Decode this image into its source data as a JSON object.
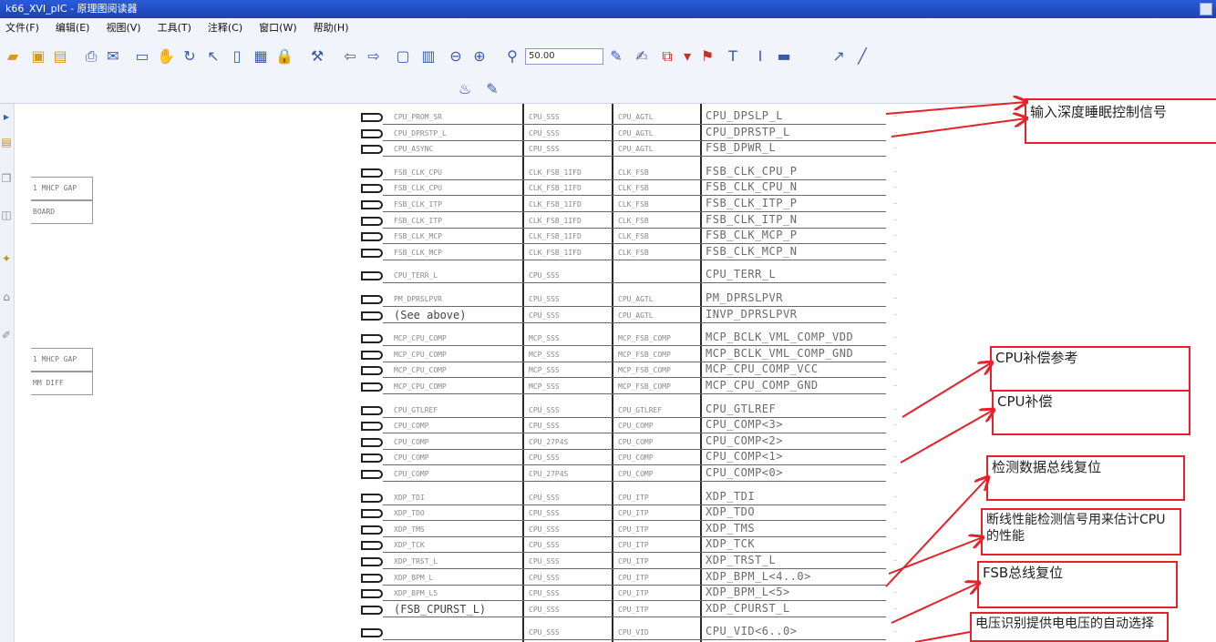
{
  "window": {
    "title": "k66_XVI_pIC   - 原理图阅读器"
  },
  "menu": [
    "文件(F)",
    "编辑(E)",
    "视图(V)",
    "工具(T)",
    "注释(C)",
    "窗口(W)",
    "帮助(H)"
  ],
  "toolbar": {
    "zoom_value": "50.00",
    "icons": [
      "open-folder-icon",
      "save-icon",
      "save-all-icon",
      "print-icon",
      "email-icon",
      "screen-icon",
      "hand-icon",
      "rotate-icon",
      "select-icon",
      "page-icon",
      "image-icon",
      "lock-icon",
      "tools-icon",
      "arrow-left-icon",
      "arrow-right-icon",
      "fit-page-icon",
      "fit-width-icon",
      "zoom-out-icon",
      "zoom-in-icon",
      "binoculars-icon",
      "highlighter-icon",
      "stamp-icon",
      "attach-icon",
      "markup-icon",
      "flag-icon",
      "textbox-icon",
      "text-icon",
      "note-icon",
      "arrow-draw-icon",
      "line-draw-icon"
    ]
  },
  "left_pane": {
    "boxes": [
      {
        "label": "1 MHCP GAP"
      },
      {
        "label": "BOARD"
      },
      {
        "label": "1 MHCP GAP"
      },
      {
        "label": "MM DIFF"
      }
    ]
  },
  "schematic": {
    "rows": [
      {
        "c1": "CPU_PROM_SR",
        "c2": "CPU_SSS",
        "c3": "CPU_AGTL",
        "net": "CPU_DPSLP_L",
        "group": 0
      },
      {
        "c1": "CPU_DPRSTP_L",
        "c2": "CPU_SSS",
        "c3": "CPU_AGTL",
        "net": "CPU_DPRSTP_L",
        "group": 0
      },
      {
        "c1": "CPU_ASYNC",
        "c2": "CPU_SSS",
        "c3": "CPU_AGTL",
        "net": "FSB_DPWR_L",
        "group": 0
      },
      {
        "c1": "FSB_CLK_CPU",
        "c2": "CLK_FSB_1IFD",
        "c3": "CLK_FSB",
        "net": "FSB_CLK_CPU_P",
        "group": 1
      },
      {
        "c1": "FSB_CLK_CPU",
        "c2": "CLK_FSB_1IFD",
        "c3": "CLK_FSB",
        "net": "FSB_CLK_CPU_N",
        "group": 1
      },
      {
        "c1": "FSB_CLK_ITP",
        "c2": "CLK_FSB_1IFD",
        "c3": "CLK_FSB",
        "net": "FSB_CLK_ITP_P",
        "group": 1
      },
      {
        "c1": "FSB_CLK_ITP",
        "c2": "CLK_FSB_1IFD",
        "c3": "CLK_FSB",
        "net": "FSB_CLK_ITP_N",
        "group": 1
      },
      {
        "c1": "FSB_CLK_MCP",
        "c2": "CLK_FSB_1IFD",
        "c3": "CLK_FSB",
        "net": "FSB_CLK_MCP_P",
        "group": 1
      },
      {
        "c1": "FSB_CLK_MCP",
        "c2": "CLK_FSB_1IFD",
        "c3": "CLK_FSB",
        "net": "FSB_CLK_MCP_N",
        "group": 1
      },
      {
        "c1": "CPU_TERR_L",
        "c2": "CPU_SSS",
        "c3": "",
        "net": "CPU_TERR_L",
        "group": 2
      },
      {
        "c1": "PM_DPRSLPVR",
        "c2": "CPU_SSS",
        "c3": "CPU_AGTL",
        "net": "PM_DPRSLPVR",
        "group": 3
      },
      {
        "c1": "(See above)",
        "c2": "CPU_SSS",
        "c3": "CPU_AGTL",
        "net": "INVP_DPRSLPVR",
        "group": 3,
        "big": true
      },
      {
        "c1": "MCP_CPU_COMP",
        "c2": "MCP_SSS",
        "c3": "MCP_FSB_COMP",
        "net": "MCP_BCLK_VML_COMP_VDD",
        "group": 4
      },
      {
        "c1": "MCP_CPU_COMP",
        "c2": "MCP_SSS",
        "c3": "MCP_FSB_COMP",
        "net": "MCP_BCLK_VML_COMP_GND",
        "group": 4
      },
      {
        "c1": "MCP_CPU_COMP",
        "c2": "MCP_SSS",
        "c3": "MCP_FSB_COMP",
        "net": "MCP_CPU_COMP_VCC",
        "group": 4
      },
      {
        "c1": "MCP_CPU_COMP",
        "c2": "MCP_SSS",
        "c3": "MCP_FSB_COMP",
        "net": "MCP_CPU_COMP_GND",
        "group": 4
      },
      {
        "c1": "CPU_GTLREF",
        "c2": "CPU_SSS",
        "c3": "CPU_GTLREF",
        "net": "CPU_GTLREF",
        "group": 5
      },
      {
        "c1": "CPU_COMP",
        "c2": "CPU_SSS",
        "c3": "CPU_COMP",
        "net": "CPU_COMP<3>",
        "group": 5
      },
      {
        "c1": "CPU_COMP",
        "c2": "CPU_27P4S",
        "c3": "CPU_COMP",
        "net": "CPU_COMP<2>",
        "group": 5
      },
      {
        "c1": "CPU_COMP",
        "c2": "CPU_SSS",
        "c3": "CPU_COMP",
        "net": "CPU_COMP<1>",
        "group": 5
      },
      {
        "c1": "CPU_COMP",
        "c2": "CPU_27P4S",
        "c3": "CPU_COMP",
        "net": "CPU_COMP<0>",
        "group": 5
      },
      {
        "c1": "XDP_TDI",
        "c2": "CPU_SSS",
        "c3": "CPU_ITP",
        "net": "XDP_TDI",
        "group": 6
      },
      {
        "c1": "XDP_TDO",
        "c2": "CPU_SSS",
        "c3": "CPU_ITP",
        "net": "XDP_TDO",
        "group": 6
      },
      {
        "c1": "XDP_TMS",
        "c2": "CPU_SSS",
        "c3": "CPU_ITP",
        "net": "XDP_TMS",
        "group": 6
      },
      {
        "c1": "XDP_TCK",
        "c2": "CPU_SSS",
        "c3": "CPU_ITP",
        "net": "XDP_TCK",
        "group": 6
      },
      {
        "c1": "XDP_TRST_L",
        "c2": "CPU_SSS",
        "c3": "CPU_ITP",
        "net": "XDP_TRST_L",
        "group": 6
      },
      {
        "c1": "XDP_BPM_L",
        "c2": "CPU_SSS",
        "c3": "CPU_ITP",
        "net": "XDP_BPM_L<4..0>",
        "group": 6
      },
      {
        "c1": "XDP_BPM_L5",
        "c2": "CPU_SSS",
        "c3": "CPU_ITP",
        "net": "XDP_BPM_L<5>",
        "group": 6
      },
      {
        "c1": "(FSB_CPURST_L)",
        "c2": "CPU_SSS",
        "c3": "CPU_ITP",
        "net": "XDP_CPURST_L",
        "group": 6,
        "big": true
      },
      {
        "c1": "",
        "c2": "CPU_SSS",
        "c3": "CPU_VID",
        "net": "CPU_VID<6..0>",
        "group": 7
      }
    ]
  },
  "annotations": [
    {
      "text": "输入深度睡眠控制信号"
    },
    {
      "text": "CPU补偿参考"
    },
    {
      "text": "CPU补偿"
    },
    {
      "text": "检测数据总线复位"
    },
    {
      "text": "断线性能检测信号用来估计CPU的性能"
    },
    {
      "text": "FSB总线复位"
    },
    {
      "text": "电压识别提供电电压的自动选择"
    }
  ],
  "colors": {
    "annotation_border": "#e8202a",
    "titlebar": "#1b43b0",
    "wire": "#6a6a6a"
  }
}
